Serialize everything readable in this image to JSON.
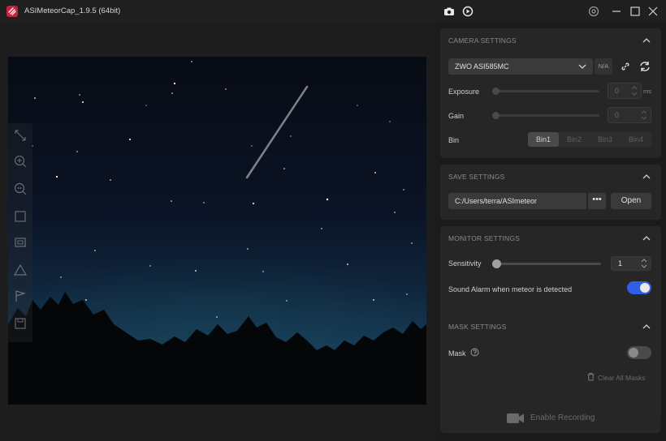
{
  "app": {
    "title": "ASIMeteorCap_1.9.5 (64bit)"
  },
  "camera": {
    "header": "CAMERA SETTINGS",
    "device": "ZWO ASI585MC",
    "device_status": "N/A",
    "exposure_label": "Exposure",
    "exposure_value": "0",
    "exposure_unit": "ms",
    "gain_label": "Gain",
    "gain_value": "0",
    "bin_label": "Bin",
    "bins": [
      "Bin1",
      "Bin2",
      "Bin3",
      "Bin4"
    ],
    "selected_bin": "Bin1"
  },
  "save": {
    "header": "SAVE SETTINGS",
    "path": "C:/Users/terra/ASImeteor",
    "browse_label": "•••",
    "open_label": "Open"
  },
  "monitor": {
    "header": "MONITOR SETTINGS",
    "sensitivity_label": "Sensitivity",
    "sensitivity_value": "1",
    "alarm_label": "Sound Alarm when meteor is detected",
    "alarm_enabled": true
  },
  "mask": {
    "header": "MASK SETTINGS",
    "mask_label": "Mask",
    "mask_enabled": false,
    "clear_label": "Clear All Masks"
  },
  "recording": {
    "label": "Enable Recording"
  },
  "colors": {
    "accent": "#2f5fe6",
    "panel": "#262626",
    "background": "#1b1b1b",
    "brand": "#c8223a"
  },
  "icons": {
    "titlebar": [
      "snapshot-icon",
      "record-video-icon",
      "settings-icon",
      "minimize-icon",
      "maximize-icon",
      "close-icon"
    ],
    "vertical_toolbar": [
      "fit-screen-icon",
      "zoom-in-icon",
      "zoom-out-icon",
      "crop-icon",
      "frame-icon",
      "triangle-icon",
      "flag-icon",
      "save-frame-icon"
    ]
  }
}
